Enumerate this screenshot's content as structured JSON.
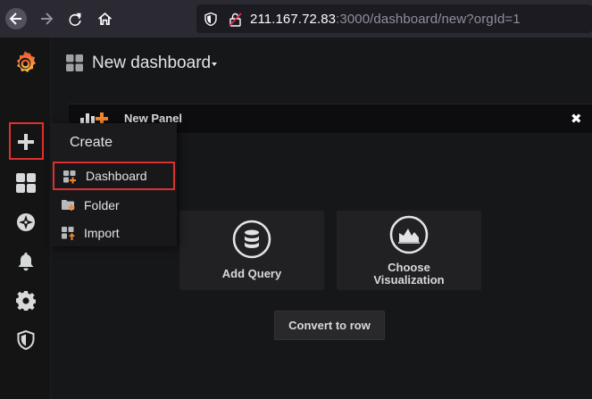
{
  "browser": {
    "url_host": "211.167.72.83",
    "url_rest": ":3000/dashboard/new?orgId=1"
  },
  "dashboard": {
    "title": "New dashboard"
  },
  "panel": {
    "title": "New Panel",
    "close_glyph": "✖",
    "add_query_label": "Add Query",
    "choose_viz_line1": "Choose",
    "choose_viz_line2": "Visualization",
    "convert_label": "Convert to row"
  },
  "create_menu": {
    "header": "Create",
    "items": [
      {
        "label": "Dashboard"
      },
      {
        "label": "Folder"
      },
      {
        "label": "Import"
      }
    ]
  },
  "colors": {
    "accent_orange": "#f0862f",
    "highlight_red": "#e02f2f"
  },
  "icons": {
    "sidebar": [
      "grafana-logo-icon",
      "plus-icon",
      "dashboards-icon",
      "explore-icon",
      "bell-icon",
      "gear-icon",
      "shield-icon"
    ]
  }
}
